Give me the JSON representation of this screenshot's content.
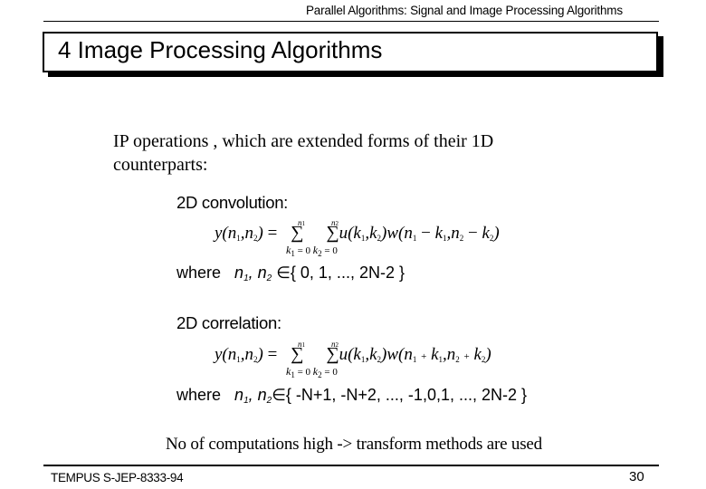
{
  "header": {
    "running_title": "Parallel Algorithms:  Signal and Image Processing Algorithms"
  },
  "slide": {
    "title": "4 Image Processing Algorithms",
    "intro_line1": "IP operations , which are extended forms of their 1D",
    "intro_line2": "counterparts:",
    "convolution": {
      "heading": "2D convolution:",
      "lhs": "y(n",
      "formula_display": "y(n1,n2) = Σ_{k1=0}^{n1} Σ_{k2=0}^{n2} u(k1,k2) w(n1−k1, n2−k2)",
      "operator": "−",
      "upper1": "n",
      "upper2": "n",
      "where_label": "where",
      "where_vars": "n",
      "where_set": "∈{ 0, 1, ..., 2N-2 }"
    },
    "correlation": {
      "heading": "2D correlation:",
      "formula_display": "y(n1,n2) = Σ_{k1=0}^{n1} Σ_{k2=0}^{n2} u(k1,k2) w(n1+k1, n2+k2)",
      "operator": "+",
      "where_label": "where",
      "where_set": "∈{ -N+1, -N+2, ..., -1,0,1, ..., 2N-2 }"
    },
    "conclusion": "No of computations high  ->  transform methods are used"
  },
  "footer": {
    "left_text": "TEMPUS S-JEP-8333-94",
    "page_number": "30"
  }
}
